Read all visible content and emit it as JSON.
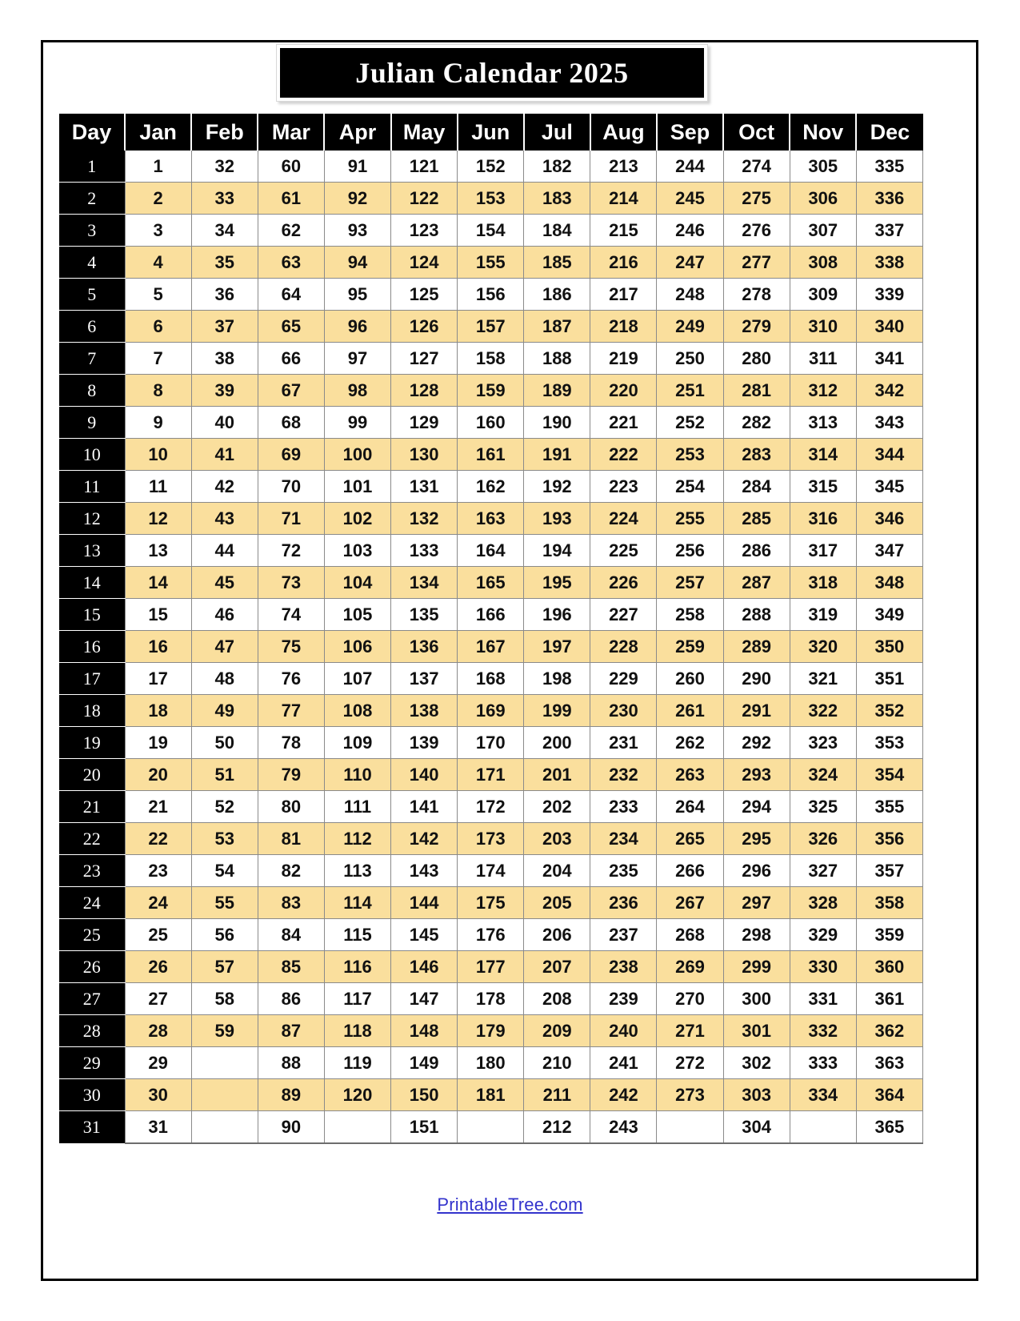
{
  "document": {
    "title": "Julian Calendar 2025",
    "year": "2025"
  },
  "table": {
    "day_header": "Day",
    "month_headers": [
      "Jan",
      "Feb",
      "Mar",
      "Apr",
      "May",
      "Jun",
      "Jul",
      "Aug",
      "Sep",
      "Oct",
      "Nov",
      "Dec"
    ],
    "day_labels": [
      "1",
      "2",
      "3",
      "4",
      "5",
      "6",
      "7",
      "8",
      "9",
      "10",
      "11",
      "12",
      "13",
      "14",
      "15",
      "16",
      "17",
      "18",
      "19",
      "20",
      "21",
      "22",
      "23",
      "24",
      "25",
      "26",
      "27",
      "28",
      "29",
      "30",
      "31"
    ],
    "rows": [
      [
        "1",
        "1",
        "32",
        "60",
        "91",
        "121",
        "152",
        "182",
        "213",
        "244",
        "274",
        "305",
        "335"
      ],
      [
        "2",
        "2",
        "33",
        "61",
        "92",
        "122",
        "153",
        "183",
        "214",
        "245",
        "275",
        "306",
        "336"
      ],
      [
        "3",
        "3",
        "34",
        "62",
        "93",
        "123",
        "154",
        "184",
        "215",
        "246",
        "276",
        "307",
        "337"
      ],
      [
        "4",
        "4",
        "35",
        "63",
        "94",
        "124",
        "155",
        "185",
        "216",
        "247",
        "277",
        "308",
        "338"
      ],
      [
        "5",
        "5",
        "36",
        "64",
        "95",
        "125",
        "156",
        "186",
        "217",
        "248",
        "278",
        "309",
        "339"
      ],
      [
        "6",
        "6",
        "37",
        "65",
        "96",
        "126",
        "157",
        "187",
        "218",
        "249",
        "279",
        "310",
        "340"
      ],
      [
        "7",
        "7",
        "38",
        "66",
        "97",
        "127",
        "158",
        "188",
        "219",
        "250",
        "280",
        "311",
        "341"
      ],
      [
        "8",
        "8",
        "39",
        "67",
        "98",
        "128",
        "159",
        "189",
        "220",
        "251",
        "281",
        "312",
        "342"
      ],
      [
        "9",
        "9",
        "40",
        "68",
        "99",
        "129",
        "160",
        "190",
        "221",
        "252",
        "282",
        "313",
        "343"
      ],
      [
        "10",
        "10",
        "41",
        "69",
        "100",
        "130",
        "161",
        "191",
        "222",
        "253",
        "283",
        "314",
        "344"
      ],
      [
        "11",
        "11",
        "42",
        "70",
        "101",
        "131",
        "162",
        "192",
        "223",
        "254",
        "284",
        "315",
        "345"
      ],
      [
        "12",
        "12",
        "43",
        "71",
        "102",
        "132",
        "163",
        "193",
        "224",
        "255",
        "285",
        "316",
        "346"
      ],
      [
        "13",
        "13",
        "44",
        "72",
        "103",
        "133",
        "164",
        "194",
        "225",
        "256",
        "286",
        "317",
        "347"
      ],
      [
        "14",
        "14",
        "45",
        "73",
        "104",
        "134",
        "165",
        "195",
        "226",
        "257",
        "287",
        "318",
        "348"
      ],
      [
        "15",
        "15",
        "46",
        "74",
        "105",
        "135",
        "166",
        "196",
        "227",
        "258",
        "288",
        "319",
        "349"
      ],
      [
        "16",
        "16",
        "47",
        "75",
        "106",
        "136",
        "167",
        "197",
        "228",
        "259",
        "289",
        "320",
        "350"
      ],
      [
        "17",
        "17",
        "48",
        "76",
        "107",
        "137",
        "168",
        "198",
        "229",
        "260",
        "290",
        "321",
        "351"
      ],
      [
        "18",
        "18",
        "49",
        "77",
        "108",
        "138",
        "169",
        "199",
        "230",
        "261",
        "291",
        "322",
        "352"
      ],
      [
        "19",
        "19",
        "50",
        "78",
        "109",
        "139",
        "170",
        "200",
        "231",
        "262",
        "292",
        "323",
        "353"
      ],
      [
        "20",
        "20",
        "51",
        "79",
        "110",
        "140",
        "171",
        "201",
        "232",
        "263",
        "293",
        "324",
        "354"
      ],
      [
        "21",
        "21",
        "52",
        "80",
        "111",
        "141",
        "172",
        "202",
        "233",
        "264",
        "294",
        "325",
        "355"
      ],
      [
        "22",
        "22",
        "53",
        "81",
        "112",
        "142",
        "173",
        "203",
        "234",
        "265",
        "295",
        "326",
        "356"
      ],
      [
        "23",
        "23",
        "54",
        "82",
        "113",
        "143",
        "174",
        "204",
        "235",
        "266",
        "296",
        "327",
        "357"
      ],
      [
        "24",
        "24",
        "55",
        "83",
        "114",
        "144",
        "175",
        "205",
        "236",
        "267",
        "297",
        "328",
        "358"
      ],
      [
        "25",
        "25",
        "56",
        "84",
        "115",
        "145",
        "176",
        "206",
        "237",
        "268",
        "298",
        "329",
        "359"
      ],
      [
        "26",
        "26",
        "57",
        "85",
        "116",
        "146",
        "177",
        "207",
        "238",
        "269",
        "299",
        "330",
        "360"
      ],
      [
        "27",
        "27",
        "58",
        "86",
        "117",
        "147",
        "178",
        "208",
        "239",
        "270",
        "300",
        "331",
        "361"
      ],
      [
        "28",
        "28",
        "59",
        "87",
        "118",
        "148",
        "179",
        "209",
        "240",
        "271",
        "301",
        "332",
        "362"
      ],
      [
        "29",
        "29",
        "",
        "88",
        "119",
        "149",
        "180",
        "210",
        "241",
        "272",
        "302",
        "333",
        "363"
      ],
      [
        "30",
        "30",
        "",
        "89",
        "120",
        "150",
        "181",
        "211",
        "242",
        "273",
        "303",
        "334",
        "364"
      ],
      [
        "31",
        "31",
        "",
        "90",
        "",
        "151",
        "",
        "212",
        "243",
        "",
        "304",
        "",
        "365"
      ]
    ]
  },
  "footer": {
    "link_text": "PrintableTree.com"
  },
  "colors": {
    "header_bg": "#000000",
    "header_text": "#ffffff",
    "row_alt_bg": "#fadf9d",
    "row_bg": "#ffffff",
    "cell_border": "#8a8a8a",
    "link": "#3333cc",
    "page_border": "#000000"
  }
}
